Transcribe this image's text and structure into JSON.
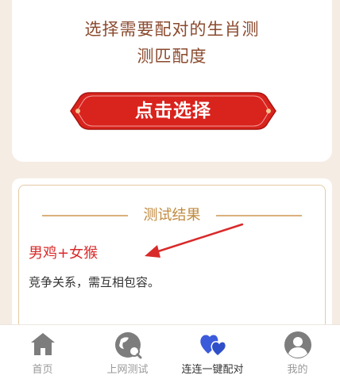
{
  "prompt": {
    "line1": "选择需要配对的生肖测",
    "line2": "测匹配度"
  },
  "select_button": {
    "label": "点击选择"
  },
  "result": {
    "heading": "测试结果",
    "pair": "男鸡+女猴",
    "description": "竞争关系，需互相包容。"
  },
  "nav": {
    "items": [
      {
        "label": "首页",
        "icon": "home-icon"
      },
      {
        "label": "上网测试",
        "icon": "globe-icon"
      },
      {
        "label": "连连一键配对",
        "icon": "hearts-icon"
      },
      {
        "label": "我的",
        "icon": "user-icon"
      }
    ],
    "active_index": 2
  },
  "colors": {
    "page_bg": "#f5ece4",
    "prompt_text": "#8a4a2e",
    "button_red": "#d9231d",
    "gold": "#c08a3e",
    "pair_red": "#d92a2a",
    "active_icon": "#3b5bdb",
    "inactive_icon": "#7d7d7d",
    "arrow": "#d92a2a"
  }
}
